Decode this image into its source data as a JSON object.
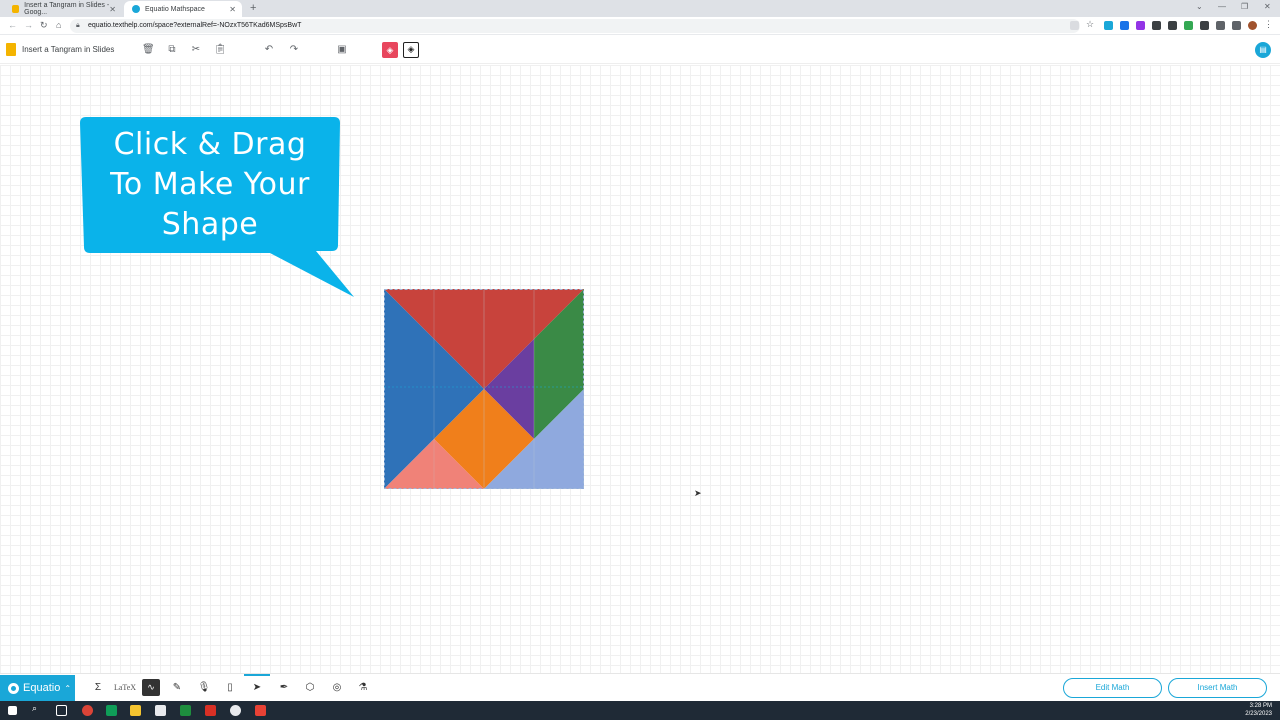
{
  "browser": {
    "tabs": [
      {
        "label": "Insert a Tangram in Slides - Goog..."
      },
      {
        "label": "Equatio Mathspace"
      }
    ],
    "new_tab": "+",
    "url": "equatio.texthelp.com/space?externalRef=-NOzxT56TKad6MSpsBwT"
  },
  "app": {
    "doc_title": "Insert a Tangram in Slides",
    "fill_icon": "paint-bucket-icon",
    "stroke_icon": "paint-bucket-outline-icon",
    "brand_color": "#1aa7d8"
  },
  "canvas": {
    "callout_lines": [
      "Click & Drag",
      "To Make Your",
      "Shape"
    ],
    "callout_color": "#0ab3ea",
    "tangram_colors": {
      "top": "#c8433c",
      "left": "#2f72b8",
      "green": "#3a8a46",
      "purple": "#6a3ea0",
      "orange": "#f07f1b",
      "pink": "#f08278",
      "lightblue": "#8fa9de"
    }
  },
  "equatio_bar": {
    "brand": "Equatio",
    "latex_label": "LaTeX",
    "sigma": "Σ",
    "edit_math": "Edit Math",
    "insert_math": "Insert Math"
  },
  "taskbar": {
    "time": "3:28 PM",
    "date": "2/23/2023"
  }
}
